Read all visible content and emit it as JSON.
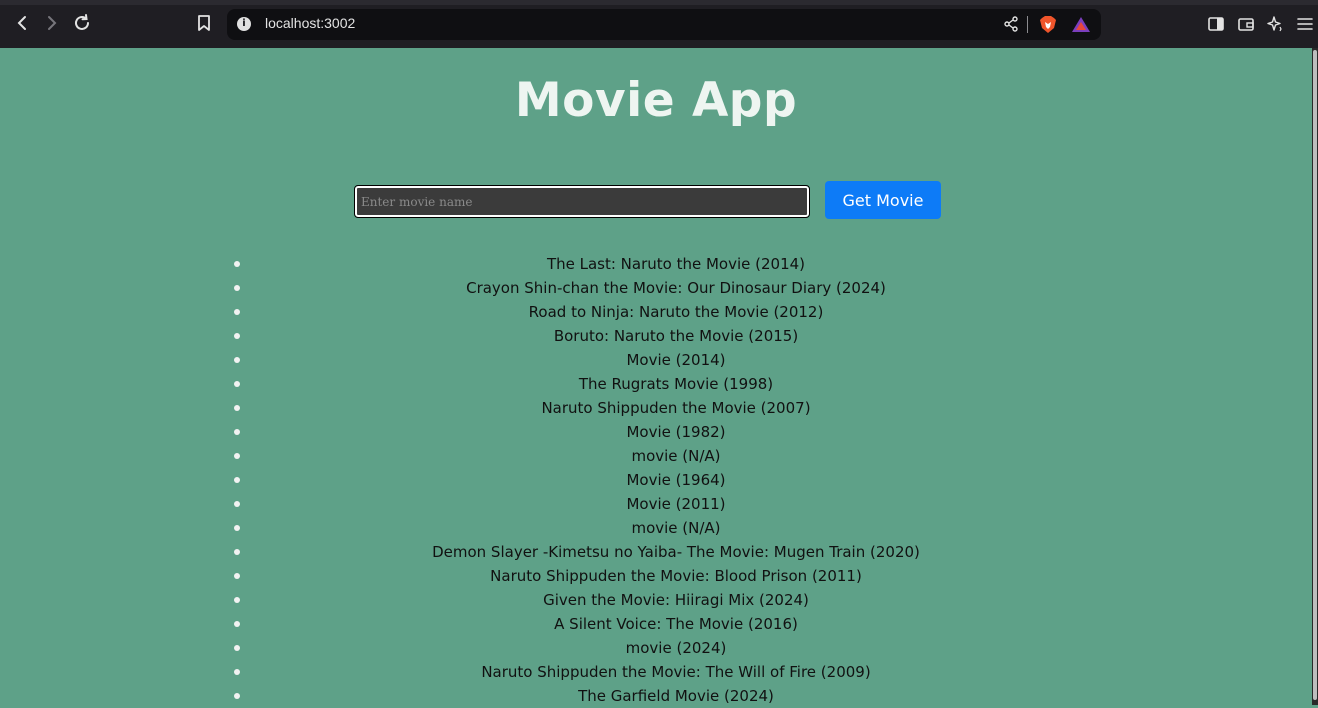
{
  "browser": {
    "url": "localhost:3002"
  },
  "app": {
    "title": "Movie App",
    "search": {
      "placeholder": "Enter movie name",
      "value": ""
    },
    "button_label": "Get Movie",
    "movies": [
      "The Last: Naruto the Movie (2014)",
      "Crayon Shin-chan the Movie: Our Dinosaur Diary (2024)",
      "Road to Ninja: Naruto the Movie (2012)",
      "Boruto: Naruto the Movie (2015)",
      "Movie (2014)",
      "The Rugrats Movie (1998)",
      "Naruto Shippuden the Movie (2007)",
      "Movie (1982)",
      "movie (N/A)",
      "Movie (1964)",
      "Movie (2011)",
      "movie (N/A)",
      "Demon Slayer -Kimetsu no Yaiba- The Movie: Mugen Train (2020)",
      "Naruto Shippuden the Movie: Blood Prison (2011)",
      "Given the Movie: Hiiragi Mix (2024)",
      "A Silent Voice: The Movie (2016)",
      "movie (2024)",
      "Naruto Shippuden the Movie: The Will of Fire (2009)",
      "The Garfield Movie (2024)"
    ]
  },
  "colors": {
    "page_background": "#5ea188",
    "button_background": "#0d7bf7",
    "title_color": "#eef5f1"
  }
}
